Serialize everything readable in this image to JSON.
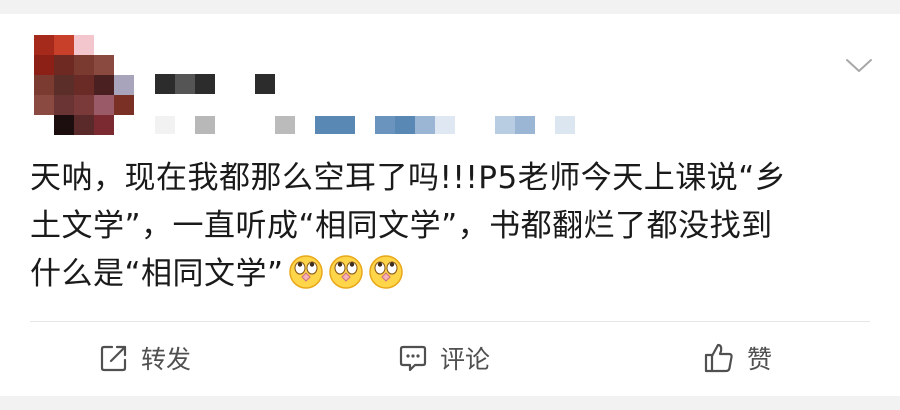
{
  "post": {
    "text_line1": "天呐，现在我都那么空耳了吗!!!P5老师今天上课说“乡",
    "text_line2": "土文学”，一直听成“相同文学”，书都翻烂了都没找到",
    "text_line3": "什么是“相同文学”",
    "emojis": [
      "rolling-eyes-emoji",
      "rolling-eyes-emoji",
      "rolling-eyes-emoji"
    ]
  },
  "actions": {
    "repost_label": "转发",
    "comment_label": "评论",
    "like_label": "赞"
  },
  "colors": {
    "page_bg": "#f2f2f2",
    "card_bg": "#ffffff",
    "text": "#1a1a1a",
    "action_text": "#505050",
    "divider": "#e6e6e6",
    "meta_blue": "#5a88b5"
  },
  "icons": {
    "menu": "chevron-down-icon",
    "repost": "repost-icon",
    "comment": "comment-icon",
    "like": "thumbs-up-icon"
  }
}
